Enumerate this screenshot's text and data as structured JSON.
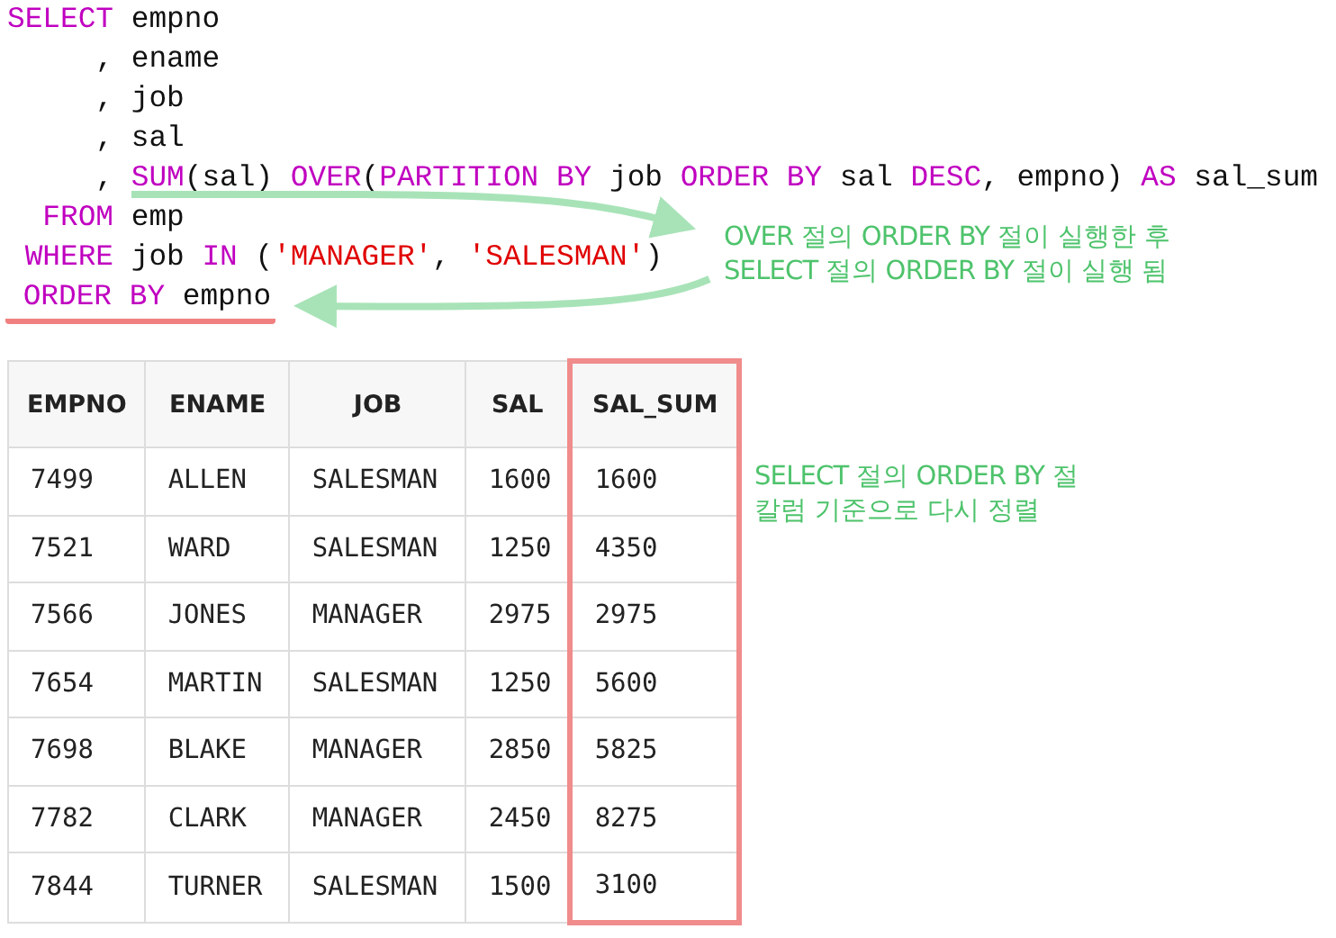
{
  "code": {
    "lines": [
      {
        "tokens": [
          {
            "kind": "keyword",
            "text": "SELECT"
          },
          {
            "kind": "plain",
            "text": " empno"
          }
        ]
      },
      {
        "tokens": [
          {
            "kind": "plain",
            "text": "     , ename"
          }
        ]
      },
      {
        "tokens": [
          {
            "kind": "plain",
            "text": "     , job"
          }
        ]
      },
      {
        "tokens": [
          {
            "kind": "plain",
            "text": "     , sal"
          }
        ]
      },
      {
        "tokens": [
          {
            "kind": "plain",
            "text": "     , "
          },
          {
            "kind": "keyword",
            "text": "SUM"
          },
          {
            "kind": "plain",
            "text": "(sal) "
          },
          {
            "kind": "keyword",
            "text": "OVER"
          },
          {
            "kind": "plain",
            "text": "("
          },
          {
            "kind": "keyword",
            "text": "PARTITION BY"
          },
          {
            "kind": "plain",
            "text": " job "
          },
          {
            "kind": "keyword",
            "text": "ORDER BY"
          },
          {
            "kind": "plain",
            "text": " sal "
          },
          {
            "kind": "keyword",
            "text": "DESC"
          },
          {
            "kind": "plain",
            "text": ", empno) "
          },
          {
            "kind": "keyword",
            "text": "AS"
          },
          {
            "kind": "plain",
            "text": " sal_sum"
          }
        ]
      },
      {
        "tokens": [
          {
            "kind": "keyword",
            "text": "  FROM"
          },
          {
            "kind": "plain",
            "text": " emp"
          }
        ]
      },
      {
        "tokens": [
          {
            "kind": "keyword",
            "text": " WHERE"
          },
          {
            "kind": "plain",
            "text": " job "
          },
          {
            "kind": "keyword",
            "text": "IN"
          },
          {
            "kind": "plain",
            "text": " ("
          },
          {
            "kind": "string",
            "text": "'MANAGER'"
          },
          {
            "kind": "plain",
            "text": ", "
          },
          {
            "kind": "string",
            "text": "'SALESMAN'"
          },
          {
            "kind": "plain",
            "text": ")"
          }
        ]
      },
      {
        "tokens": [
          {
            "kind": "keyword",
            "text": " ORDER BY"
          },
          {
            "kind": "plain",
            "text": " empno"
          }
        ],
        "underlined": true
      }
    ]
  },
  "notes": [
    {
      "lines": [
        "OVER 절의 ORDER BY 절이 실행한 후",
        "SELECT 절의 ORDER BY 절이 실행 됨"
      ]
    },
    {
      "lines": [
        "SELECT 절의 ORDER BY 절",
        "칼럼 기준으로 다시 정렬"
      ]
    }
  ],
  "table": {
    "columns": [
      {
        "label": "EMPNO",
        "highlighted": false
      },
      {
        "label": "ENAME",
        "highlighted": false
      },
      {
        "label": "JOB",
        "highlighted": false
      },
      {
        "label": "SAL",
        "highlighted": false
      },
      {
        "label": "SAL_SUM",
        "highlighted": true
      }
    ],
    "rows": [
      [
        "7499",
        "ALLEN",
        "SALESMAN",
        "1600",
        "1600"
      ],
      [
        "7521",
        "WARD",
        "SALESMAN",
        "1250",
        "4350"
      ],
      [
        "7566",
        "JONES",
        "MANAGER",
        "2975",
        "2975"
      ],
      [
        "7654",
        "MARTIN",
        "SALESMAN",
        "1250",
        "5600"
      ],
      [
        "7698",
        "BLAKE",
        "MANAGER",
        "2850",
        "5825"
      ],
      [
        "7782",
        "CLARK",
        "MANAGER",
        "2450",
        "8275"
      ],
      [
        "7844",
        "TURNER",
        "SALESMAN",
        "1500",
        "3100"
      ]
    ]
  }
}
